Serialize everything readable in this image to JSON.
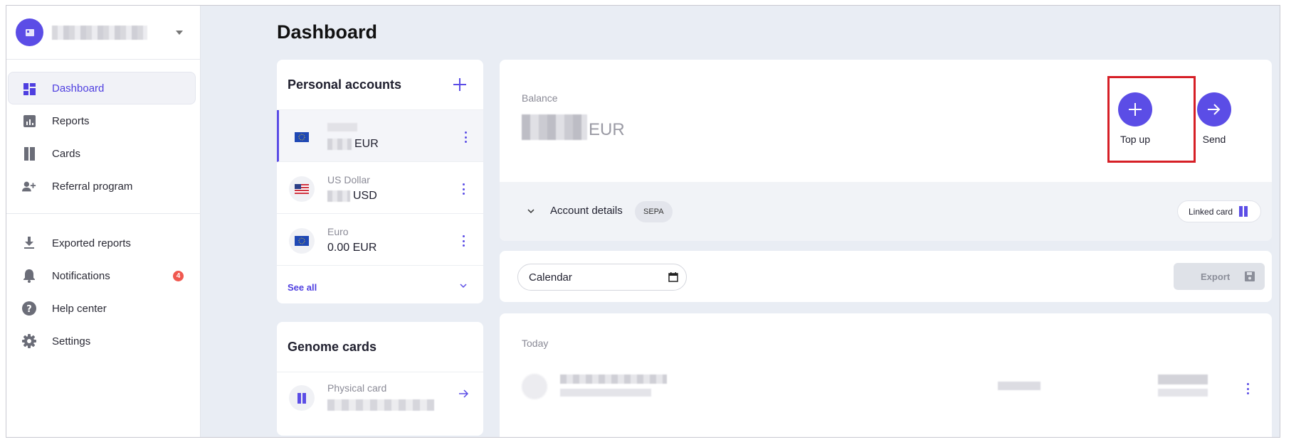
{
  "page": {
    "title": "Dashboard"
  },
  "sidebar": {
    "org_name": "",
    "items_top": [
      {
        "label": "Dashboard",
        "icon": "dashboard-icon",
        "active": true
      },
      {
        "label": "Reports",
        "icon": "reports-icon"
      },
      {
        "label": "Cards",
        "icon": "cards-icon"
      },
      {
        "label": "Referral program",
        "icon": "referral-icon"
      }
    ],
    "items_bottom": [
      {
        "label": "Exported reports",
        "icon": "download-icon"
      },
      {
        "label": "Notifications",
        "icon": "bell-icon",
        "badge": "4"
      },
      {
        "label": "Help center",
        "icon": "help-icon"
      },
      {
        "label": "Settings",
        "icon": "gear-icon"
      }
    ]
  },
  "accounts": {
    "title": "Personal accounts",
    "items": [
      {
        "name": "",
        "currency": "EUR",
        "flag": "eu-flag-icon",
        "amount": ""
      },
      {
        "name": "US Dollar",
        "currency": "USD",
        "flag": "us-flag-icon",
        "amount": ""
      },
      {
        "name": "Euro",
        "currency": "",
        "flag": "eu-flag-icon",
        "amount": "0.00 EUR"
      }
    ],
    "see_all": "See all"
  },
  "genome_cards": {
    "title": "Genome cards",
    "card_label": "Physical card"
  },
  "balance": {
    "label": "Balance",
    "currency": "EUR",
    "actions": {
      "top_up": "Top up",
      "send": "Send"
    },
    "details_label": "Account details",
    "sepa": "SEPA",
    "linked_card": "Linked card"
  },
  "filters": {
    "calendar_placeholder": "Calendar",
    "export_label": "Export"
  },
  "transactions": {
    "group_label": "Today"
  },
  "colors": {
    "accent": "#5b4de6",
    "badge": "#f0584f",
    "highlight": "#d61f26"
  }
}
